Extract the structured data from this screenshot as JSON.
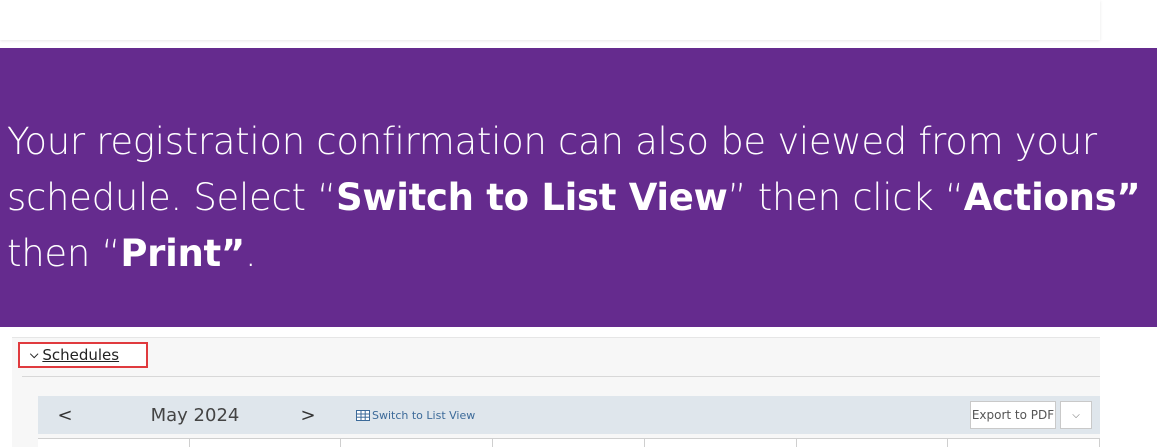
{
  "banner": {
    "line1": "Your registration confirmation can also be viewed from your",
    "line2_a": "schedule. Select “",
    "line2_b": "Switch to List View",
    "line2_c": "” then click “",
    "line2_d": "Actions”",
    "line3_a": "then “",
    "line3_b": "Print”",
    "line3_c": "."
  },
  "schedules": {
    "label": "Schedules"
  },
  "calendar": {
    "prev": "<",
    "month": "May 2024",
    "next": ">",
    "list_view_label": "Switch to List View",
    "export_label": "Export to PDF"
  },
  "colors": {
    "banner_bg": "#652b8e",
    "highlight_border": "#e03a3e",
    "link": "#3c6a99"
  },
  "icons": {
    "toggle": "chevron-down-icon",
    "list_view": "grid-icon",
    "export_dropdown": "chevron-down-icon"
  }
}
